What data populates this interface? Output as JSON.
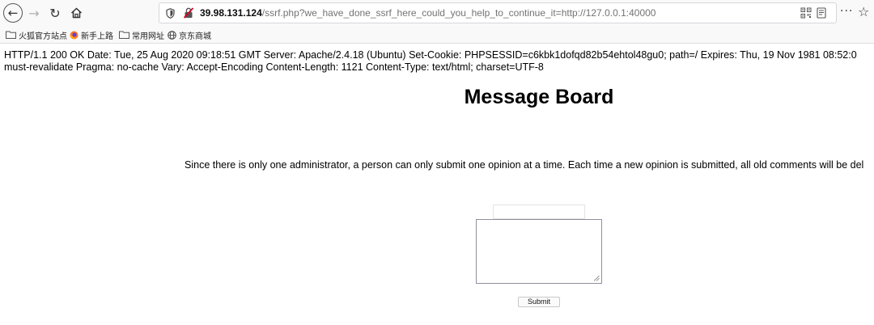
{
  "browser": {
    "url": {
      "host": "39.98.131.124",
      "path": "/ssrf.php?we_have_done_ssrf_here_could_you_help_to_continue_it=http://127.0.0.1:40000"
    },
    "nav_icons": {
      "back": "←",
      "forward": "→",
      "reload": "↻",
      "home": "⌂",
      "more": "···",
      "star": "☆"
    }
  },
  "bookmarks": [
    {
      "label": "火狐官方站点",
      "icon": "folder-icon"
    },
    {
      "label": "新手上路",
      "icon": "firefox-icon"
    },
    {
      "label": "常用网址",
      "icon": "folder-icon"
    },
    {
      "label": "京东商城",
      "icon": "globe-icon"
    }
  ],
  "page": {
    "http_header_line1": "HTTP/1.1 200 OK Date: Tue, 25 Aug 2020 09:18:51 GMT Server: Apache/2.4.18 (Ubuntu) Set-Cookie: PHPSESSID=c6kbk1dofqd82b54ehtol48gu0; path=/ Expires: Thu, 19 Nov 1981 08:52:0",
    "http_header_line2": "must-revalidate Pragma: no-cache Vary: Accept-Encoding Content-Length: 1121 Content-Type: text/html; charset=UTF-8",
    "title": "Message Board",
    "notice": "Since there is only one administrator, a person can only submit one opinion at a time. Each time a new opinion is submitted, all old comments will be del",
    "name_value": "",
    "message_value": "",
    "submit_label": "Submit"
  },
  "colors": {
    "toolbar_bg": "#f9f9fa",
    "url_host": "#0c0c0d",
    "url_path": "#737373",
    "insecure_lock": "#d70022"
  }
}
